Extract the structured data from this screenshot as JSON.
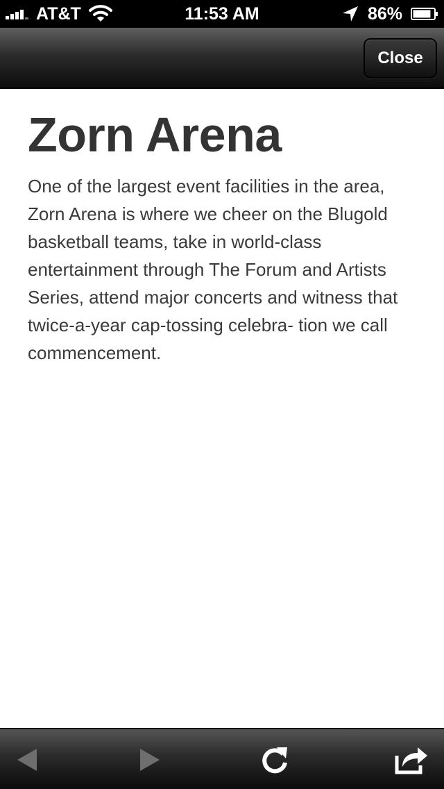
{
  "status_bar": {
    "carrier": "AT&T",
    "time": "11:53 AM",
    "battery": "86%",
    "battery_level": 0.86,
    "signal_bars": 4,
    "icons": [
      "signal-bars-icon",
      "wifi-icon",
      "location-arrow-icon",
      "battery-icon"
    ]
  },
  "nav": {
    "close_label": "Close"
  },
  "content": {
    "title": "Zorn Arena",
    "body": "One of the largest event facilities in the area, Zorn Arena is where we cheer on the Blugold basketball teams, take in world-class entertainment through The Forum and Artists Series, attend major concerts and witness that twice-a-year cap-tossing celebra- tion we call commencement."
  },
  "toolbar": {
    "icons": [
      "back-arrow-icon",
      "forward-arrow-icon",
      "reload-icon",
      "share-icon"
    ],
    "back_enabled": false,
    "forward_enabled": false
  },
  "colors": {
    "title": "#333333",
    "body": "#3a3a3a",
    "bar_top": "#5f5f5f",
    "bar_bottom": "#0c0c0c"
  }
}
